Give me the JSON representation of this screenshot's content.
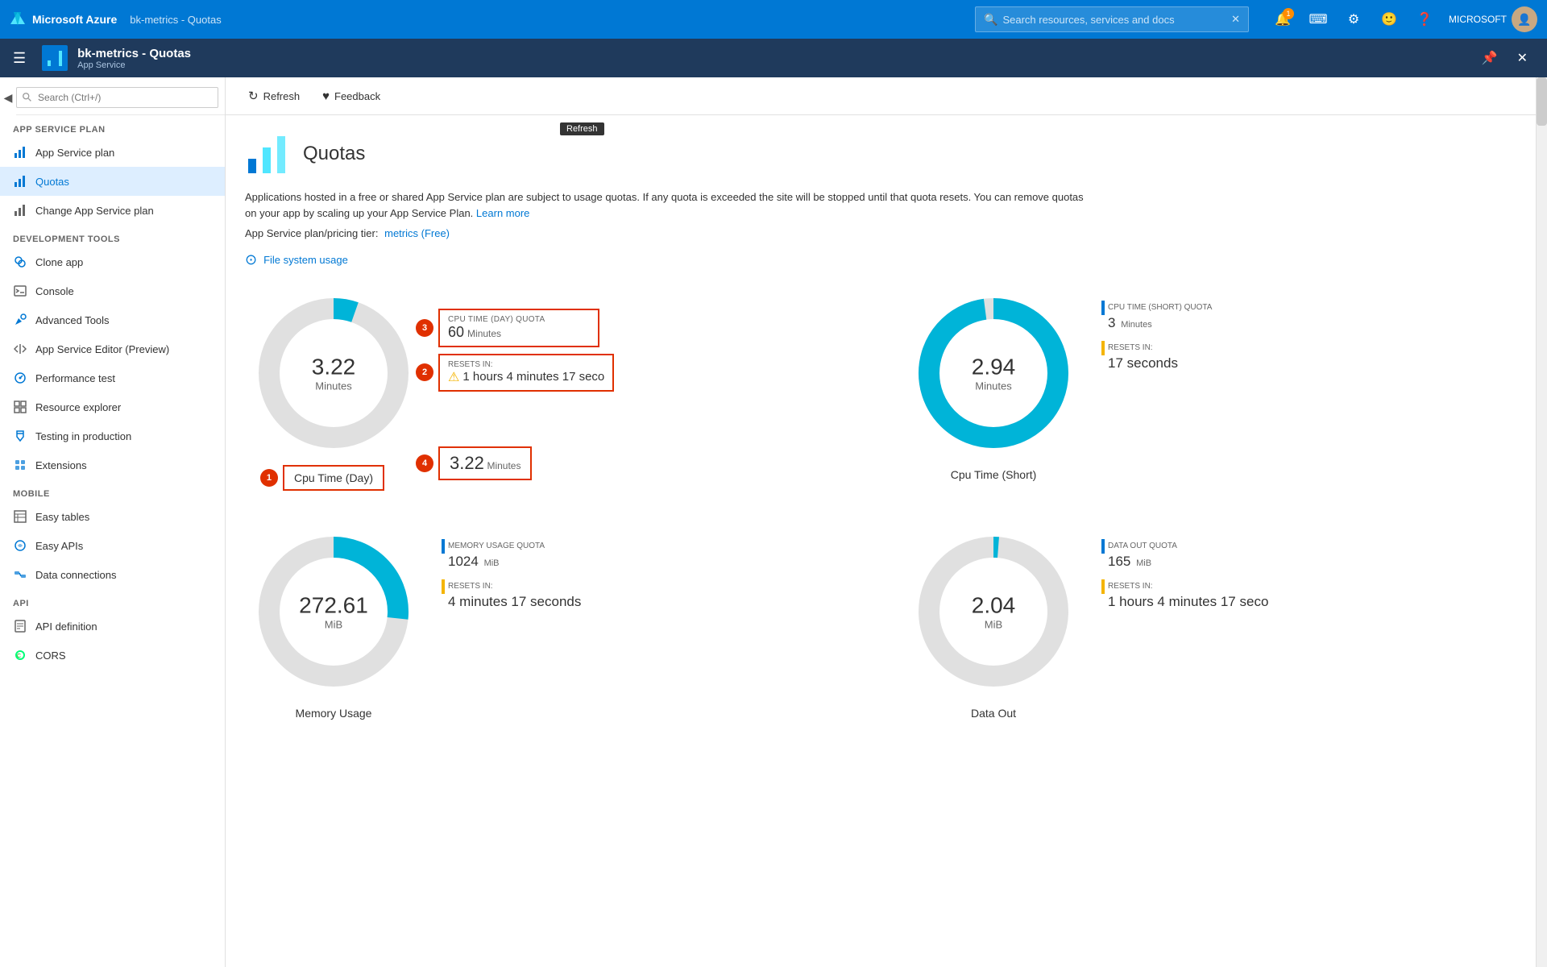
{
  "topnav": {
    "logo": "Microsoft Azure",
    "resource_path": "bk-metrics - Quotas",
    "search_placeholder": "Search resources, services and docs",
    "notification_count": "1",
    "user_label": "MICROSOFT"
  },
  "resourcebar": {
    "title": "bk-metrics - Quotas",
    "subtitle": "App Service",
    "pin_icon": "📌",
    "close_icon": "✕"
  },
  "sidebar": {
    "search_placeholder": "Search (Ctrl+/)",
    "sections": [
      {
        "label": "APP SERVICE PLAN",
        "items": [
          {
            "label": "App Service plan",
            "icon": "chart",
            "active": false
          },
          {
            "label": "Quotas",
            "icon": "quotas",
            "active": true
          },
          {
            "label": "Change App Service plan",
            "icon": "change",
            "active": false
          }
        ]
      },
      {
        "label": "DEVELOPMENT TOOLS",
        "items": [
          {
            "label": "Clone app",
            "icon": "clone",
            "active": false
          },
          {
            "label": "Console",
            "icon": "console",
            "active": false
          },
          {
            "label": "Advanced Tools",
            "icon": "advanced",
            "active": false
          },
          {
            "label": "App Service Editor (Preview)",
            "icon": "editor",
            "active": false
          },
          {
            "label": "Performance test",
            "icon": "perf",
            "active": false
          },
          {
            "label": "Resource explorer",
            "icon": "explorer",
            "active": false
          },
          {
            "label": "Testing in production",
            "icon": "testing",
            "active": false
          },
          {
            "label": "Extensions",
            "icon": "ext",
            "active": false
          }
        ]
      },
      {
        "label": "MOBILE",
        "items": [
          {
            "label": "Easy tables",
            "icon": "tables",
            "active": false
          },
          {
            "label": "Easy APIs",
            "icon": "apis",
            "active": false
          },
          {
            "label": "Data connections",
            "icon": "data",
            "active": false
          }
        ]
      },
      {
        "label": "API",
        "items": [
          {
            "label": "API definition",
            "icon": "apidef",
            "active": false
          },
          {
            "label": "CORS",
            "icon": "cors",
            "active": false
          }
        ]
      }
    ]
  },
  "toolbar": {
    "refresh_label": "Refresh",
    "feedback_label": "Feedback",
    "refresh_tooltip": "Refresh"
  },
  "page": {
    "title": "Quotas",
    "description": "Applications hosted in a free or shared App Service plan are subject to usage quotas. If any quota is exceeded the site will be stopped until that quota resets. You can remove quotas on your app by scaling up your App Service Plan.",
    "learn_more": "Learn more",
    "plan_label": "App Service plan/pricing tier:",
    "plan_link": "metrics (Free)",
    "filesystem_link": "File system usage"
  },
  "charts": {
    "cpu_day": {
      "title": "Cpu Time (Day)",
      "value": "3.22",
      "unit": "Minutes",
      "quota_label": "CPU TIME (DAY) QUOTA",
      "quota_value": "60",
      "quota_sub": "Minutes",
      "resets_label": "RESETS IN:",
      "resets_value": "1 hours 4 minutes 17 seco",
      "callout_title_num": "1",
      "callout_quota_num": "3",
      "callout_resets_num": "2",
      "callout_value_num": "4",
      "percentage": 5.37,
      "color": "#00b4d8"
    },
    "cpu_short": {
      "title": "Cpu Time (Short)",
      "value": "2.94",
      "unit": "Minutes",
      "quota_label": "CPU TIME (SHORT) QUOTA",
      "quota_value": "3",
      "quota_sub": "Minutes",
      "resets_label": "RESETS IN:",
      "resets_value": "17 seconds",
      "percentage": 98,
      "color": "#00b4d8"
    },
    "memory": {
      "title": "Memory Usage",
      "value": "272.61",
      "unit": "MiB",
      "quota_label": "MEMORY USAGE QUOTA",
      "quota_value": "1024",
      "quota_sub": "MiB",
      "resets_label": "RESETS IN:",
      "resets_value": "4 minutes 17 seconds",
      "percentage": 26.6,
      "color": "#00b4d8"
    },
    "data_out": {
      "title": "Data Out",
      "value": "2.04",
      "unit": "MiB",
      "quota_label": "DATA OUT QUOTA",
      "quota_value": "165",
      "quota_sub": "MiB",
      "resets_label": "RESETS IN:",
      "resets_value": "1 hours 4 minutes 17 seco",
      "percentage": 1.2,
      "color": "#00b4d8"
    }
  }
}
